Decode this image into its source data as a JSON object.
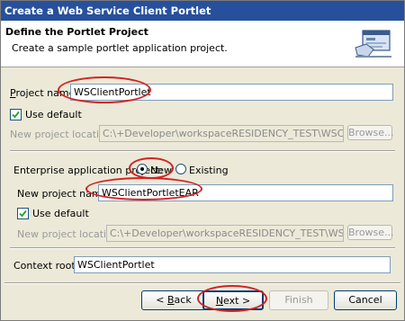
{
  "window": {
    "title": "Create a Web Service Client Portlet"
  },
  "banner": {
    "title": "Define the Portlet Project",
    "description": "Create a sample portlet application project.",
    "icon": "wizard-banner-icon"
  },
  "portlet_project": {
    "name_label_hotkey": "P",
    "name_label_rest": "roject name:",
    "name_value": "WSClientPortlet",
    "use_default_label": "Use default",
    "use_default_checked": true,
    "location_label": "New project location:",
    "location_value": "C:\\+Developer\\workspaceRESIDENCY_TEST\\WSClientPortlet",
    "browse_label": "Browse..."
  },
  "enterprise_project": {
    "label": "Enterprise application project:",
    "option_new": "New",
    "option_existing": "Existing",
    "selected": "New",
    "name_label": "New project name:",
    "name_value": "WSClientPortletEAR",
    "use_default_label": "Use default",
    "use_default_checked": true,
    "location_label": "New project location:",
    "location_value": "C:\\+Developer\\workspaceRESIDENCY_TEST\\WSClientPortlet",
    "browse_label": "Browse..."
  },
  "context_root": {
    "label": "Context root:",
    "value": "WSClientPortlet"
  },
  "buttons": {
    "back_prefix": "< ",
    "back_hotkey": "B",
    "back_rest": "ack",
    "next_hotkey": "N",
    "next_rest": "ext >",
    "finish": "Finish",
    "cancel": "Cancel"
  },
  "colors": {
    "title_bar": "#27509c",
    "dialog_bg": "#ece9d8",
    "highlight_oval": "#d22222"
  }
}
